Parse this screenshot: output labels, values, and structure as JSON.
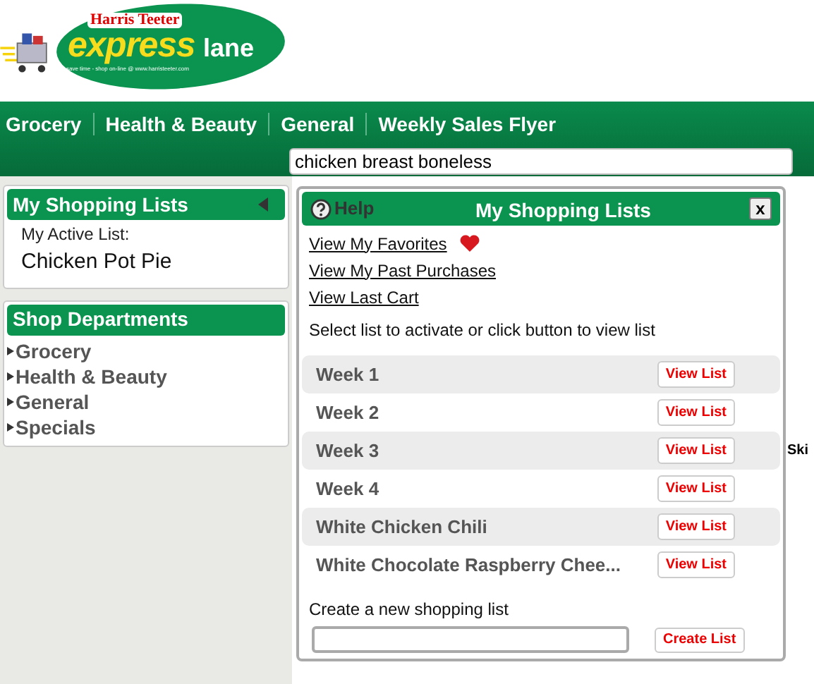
{
  "logo": {
    "brand": "Harris Teeter",
    "word_1": "express",
    "word_2": "lane",
    "tagline": "save time - shop on-line @ www.harristeeter.com"
  },
  "nav": {
    "items": [
      "Grocery",
      "Health & Beauty",
      "General",
      "Weekly Sales Flyer"
    ],
    "search": {
      "value": "chicken breast boneless"
    }
  },
  "sidebar": {
    "lists_panel": {
      "title": "My Shopping Lists",
      "expanded": true,
      "active_label": "My Active List:",
      "active_list": "Chicken Pot Pie"
    },
    "departments": {
      "title": "Shop Departments",
      "items": [
        "Grocery",
        "Health & Beauty",
        "General",
        "Specials"
      ]
    }
  },
  "background_text": "Ski",
  "popup": {
    "help": "Help",
    "title": "My Shopping Lists",
    "close": "x",
    "links": [
      {
        "label": "View My Favorites",
        "heart": true
      },
      {
        "label": "View My Past Purchases",
        "heart": false
      },
      {
        "label": "View Last Cart",
        "heart": false
      }
    ],
    "instruction": "Select list to activate or click button to view list",
    "lists": [
      {
        "name": "Week 1",
        "button": "View List"
      },
      {
        "name": "Week 2",
        "button": "View List"
      },
      {
        "name": "Week 3",
        "button": "View List"
      },
      {
        "name": "Week 4",
        "button": "View List"
      },
      {
        "name": "White Chicken Chili",
        "button": "View List"
      },
      {
        "name": "White Chocolate Raspberry Chee...",
        "button": "View List"
      }
    ],
    "create_label": "Create a new shopping list",
    "create_button": "Create List"
  }
}
